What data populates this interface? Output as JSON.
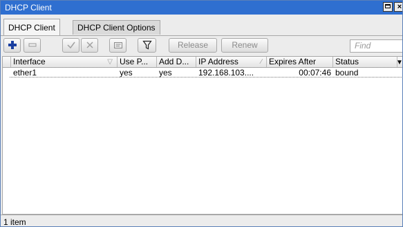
{
  "window": {
    "title": "DHCP Client"
  },
  "tabs": [
    {
      "label": "DHCP Client",
      "active": true
    },
    {
      "label": "DHCP Client Options",
      "active": false
    }
  ],
  "toolbar": {
    "add_icon": "plus-icon",
    "remove_icon": "minus-icon",
    "enable_icon": "check-icon",
    "disable_icon": "x-icon",
    "comment_icon": "comment-icon",
    "filter_icon": "filter-icon",
    "release_label": "Release",
    "renew_label": "Renew",
    "find_placeholder": "Find"
  },
  "table": {
    "columns": [
      "Interface",
      "Use P...",
      "Add D...",
      "IP Address",
      "Expires After",
      "Status"
    ],
    "rows": [
      {
        "interface": "ether1",
        "use_peer": "yes",
        "add_default": "yes",
        "ip_address": "192.168.103....",
        "expires_after": "00:07:46",
        "status": "bound"
      }
    ]
  },
  "status": {
    "count": "1 item"
  },
  "colors": {
    "titlebar": "#2f6fd0",
    "accent_add": "#1a3fa0"
  }
}
